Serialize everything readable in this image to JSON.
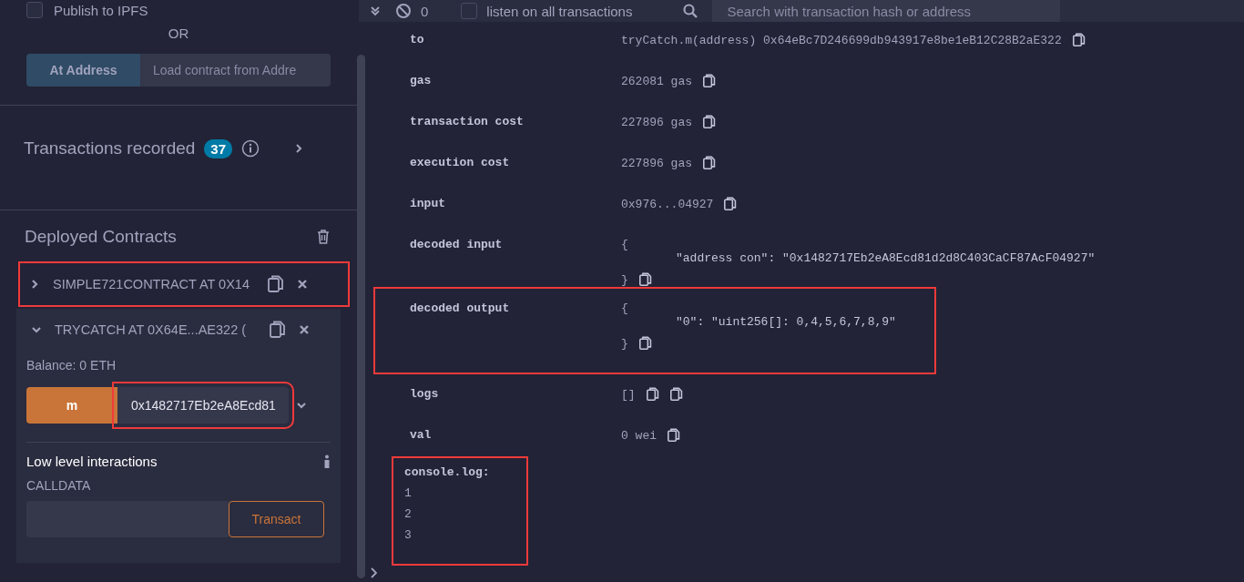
{
  "left": {
    "publish": {
      "label": "Publish to IPFS",
      "checked": false
    },
    "or": "OR",
    "at_address": {
      "button": "At Address",
      "placeholder": "Load contract from Addre"
    },
    "transactions": {
      "label": "Transactions recorded",
      "count": "37"
    },
    "deployed": {
      "title": "Deployed Contracts",
      "contracts": [
        {
          "name": "SIMPLE721CONTRACT AT 0X14",
          "expanded": false,
          "highlighted": true
        },
        {
          "name": "TRYCATCH AT 0X64E...AE322 (",
          "expanded": true,
          "highlighted": false,
          "balance": "Balance: 0 ETH",
          "functions": [
            {
              "name": "m",
              "value": "0x1482717Eb2eA8Ecd81",
              "highlighted": true
            }
          ],
          "low_level": {
            "title": "Low level interactions",
            "calldata": "CALLDATA",
            "button": "Transact"
          }
        }
      ]
    }
  },
  "terminal": {
    "pending": "0",
    "listen": {
      "label": "listen on all transactions",
      "checked": false
    },
    "search": {
      "placeholder": "Search with transaction hash or address"
    },
    "rows": [
      {
        "kind": "text",
        "key": "to",
        "value": "tryCatch.m(address) 0x64eBc7D246699db943917e8be1eB12C28B2aE322",
        "highlighted": false
      },
      {
        "kind": "text",
        "key": "gas",
        "value": "262081 gas",
        "highlighted": false
      },
      {
        "kind": "text",
        "key": "transaction cost",
        "value": "227896 gas",
        "highlighted": false
      },
      {
        "kind": "text",
        "key": "execution cost",
        "value": "227896 gas",
        "highlighted": false
      },
      {
        "kind": "text",
        "key": "input",
        "value": "0x976...04927",
        "highlighted": false
      },
      {
        "kind": "object",
        "key": "decoded input",
        "open": "{",
        "lines": [
          "\"address con\": \"0x1482717Eb2eA8Ecd81d2d8C403CaCF87AcF04927\""
        ],
        "close": "}",
        "highlighted": false
      },
      {
        "kind": "object",
        "key": "decoded output",
        "open": "{",
        "lines": [
          "\"0\": \"uint256[]: 0,4,5,6,7,8,9\""
        ],
        "close": "}",
        "highlighted": true
      },
      {
        "kind": "logs",
        "key": "logs",
        "value": "[]",
        "highlighted": false
      },
      {
        "kind": "text",
        "key": "val",
        "value": "0 wei",
        "highlighted": false
      }
    ],
    "console": {
      "title": "console.log:",
      "lines": [
        "1",
        "2",
        "3"
      ],
      "highlighted": true
    }
  }
}
